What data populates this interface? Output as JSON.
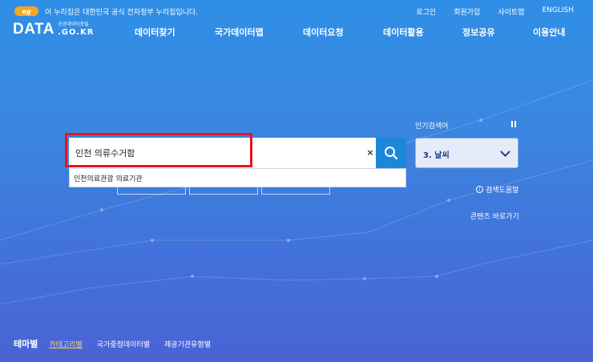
{
  "notice": {
    "logo_text": "eg",
    "text": "이 누리집은 대한민국 공식 전자정부 누리집입니다."
  },
  "util_links": [
    "로그인",
    "회원가입",
    "사이트맵",
    "ENGLISH"
  ],
  "logo": {
    "main": "DATA",
    "sub_top": "공공데이터포털",
    "sub_bottom": ".GO.KR"
  },
  "gnb": [
    "데이터찾기",
    "국가데이터맵",
    "데이터요청",
    "데이터활용",
    "정보공유",
    "이용안내"
  ],
  "search": {
    "value": "인천 의류수거함",
    "clear": "×",
    "icon": "search-icon"
  },
  "suggestions": [
    "인천의료관광 의료기관"
  ],
  "popular": {
    "title": "인기검색어",
    "selected": "3. 날씨"
  },
  "help": {
    "label": "검색도움말",
    "icon": "info-icon"
  },
  "content_link": "콘텐츠 바로가기",
  "theme": {
    "title": "테마별",
    "tabs": [
      "카테고리별",
      "국가중점데이터별",
      "제공기관유형별"
    ],
    "active_index": 0
  },
  "colors": {
    "accent": "#1e88d8",
    "highlight": "#e8141b",
    "active_tab": "#ffd35a"
  }
}
